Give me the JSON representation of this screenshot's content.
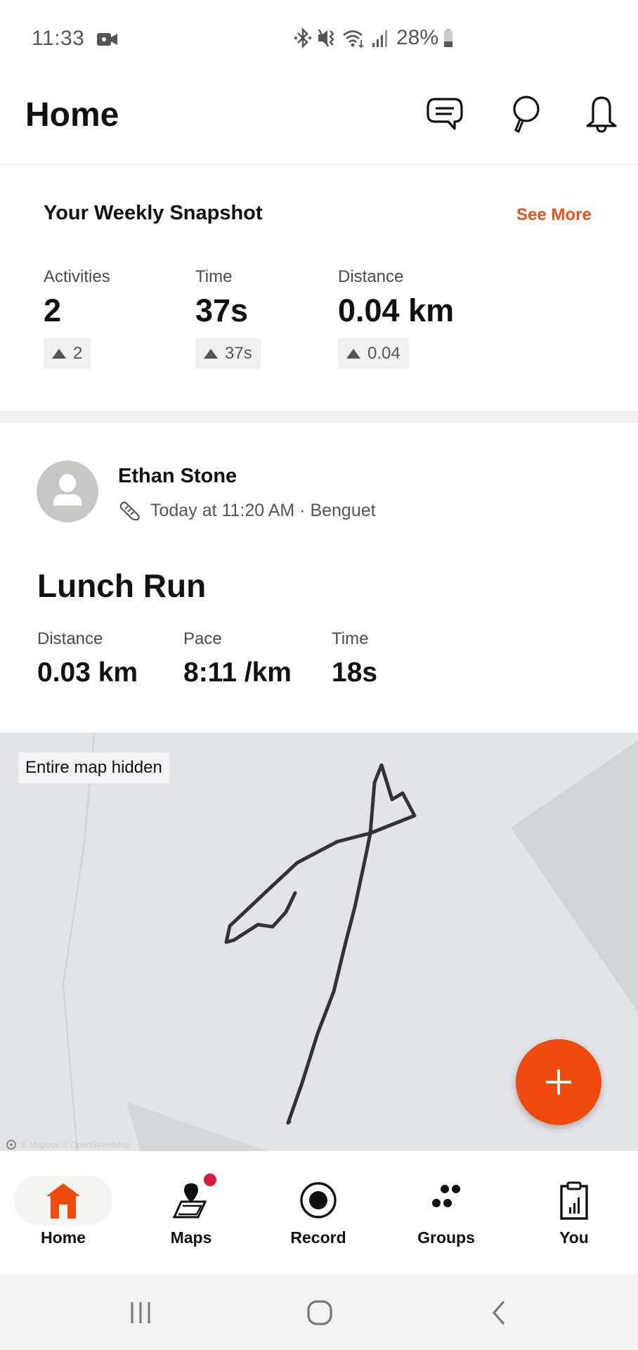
{
  "status_bar": {
    "time": "11:33",
    "battery_text": "28%",
    "icons": [
      "video-record-icon",
      "bluetooth-icon",
      "vibrate-mute-icon",
      "wifi-icon",
      "signal-icon",
      "battery-icon"
    ]
  },
  "header": {
    "title": "Home",
    "actions": [
      "chat-icon",
      "search-icon",
      "bell-icon"
    ]
  },
  "weekly_snapshot": {
    "title": "Your Weekly Snapshot",
    "see_more": "See More",
    "stats": [
      {
        "label": "Activities",
        "value": "2",
        "change": "2"
      },
      {
        "label": "Time",
        "value": "37s",
        "change": "37s"
      },
      {
        "label": "Distance",
        "value": "0.04 km",
        "change": "0.04"
      }
    ]
  },
  "activity": {
    "athlete": "Ethan Stone",
    "meta": "Today at 11:20 AM · Benguet",
    "sport_icon": "running-shoe-icon",
    "title": "Lunch Run",
    "stats": [
      {
        "label": "Distance",
        "value": "0.03 km"
      },
      {
        "label": "Pace",
        "value": "8:11 /km"
      },
      {
        "label": "Time",
        "value": "18s"
      }
    ],
    "map": {
      "label": "Entire map hidden",
      "attribution": "© Mapbox © OpenStreetMap"
    }
  },
  "fab": {
    "icon": "plus-icon"
  },
  "bottom_nav": {
    "active": "Home",
    "items": [
      {
        "label": "Home",
        "icon": "home-icon"
      },
      {
        "label": "Maps",
        "icon": "maps-icon",
        "badge": true
      },
      {
        "label": "Record",
        "icon": "record-icon"
      },
      {
        "label": "Groups",
        "icon": "groups-icon"
      },
      {
        "label": "You",
        "icon": "you-icon"
      }
    ]
  },
  "colors": {
    "accent": "#f04b0c",
    "see_more": "#e5551d",
    "badge_dot": "#d81b3c",
    "map_bg": "#e3e4e8",
    "route": "#333333"
  }
}
